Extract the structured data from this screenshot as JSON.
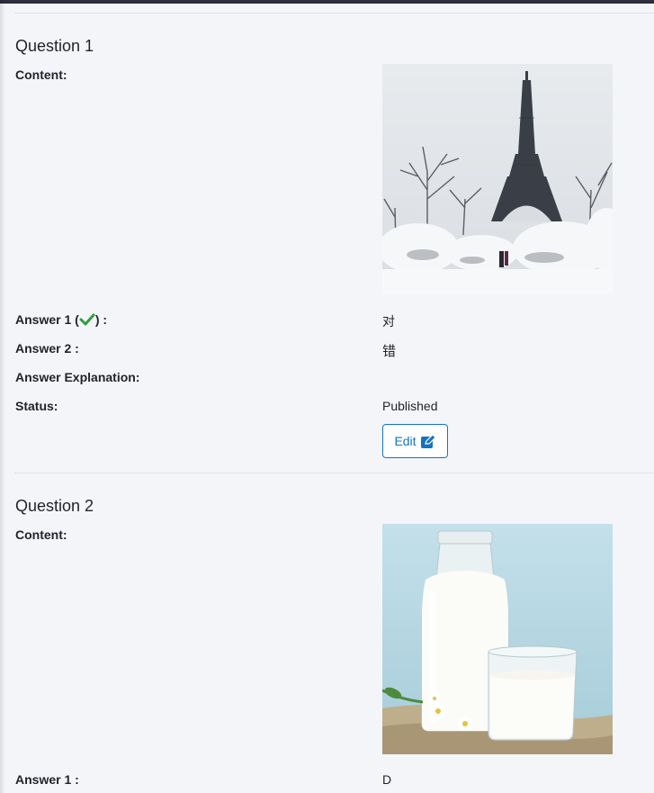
{
  "questions": [
    {
      "title": "Question 1",
      "content_label": "Content:",
      "image": "eiffel-tower-snow-photo",
      "answers": [
        {
          "label_before": "Answer 1 (",
          "label_after": ") :",
          "correct": true,
          "value": "对"
        },
        {
          "label": "Answer 2 :",
          "value": "错"
        }
      ],
      "explanation_label": "Answer Explanation:",
      "status_label": "Status:",
      "status_value": "Published",
      "edit_label": "Edit"
    },
    {
      "title": "Question 2",
      "content_label": "Content:",
      "image": "milk-bottle-glass-photo",
      "answers": [
        {
          "label": "Answer 1 :",
          "value": "D"
        }
      ]
    }
  ],
  "colors": {
    "background": "#f4f5f9",
    "primary": "#1474c4",
    "correct": "#2e9e3e",
    "top_bar": "#2f2c3d"
  },
  "icons": {
    "correct": "check-icon",
    "edit": "edit-icon"
  }
}
